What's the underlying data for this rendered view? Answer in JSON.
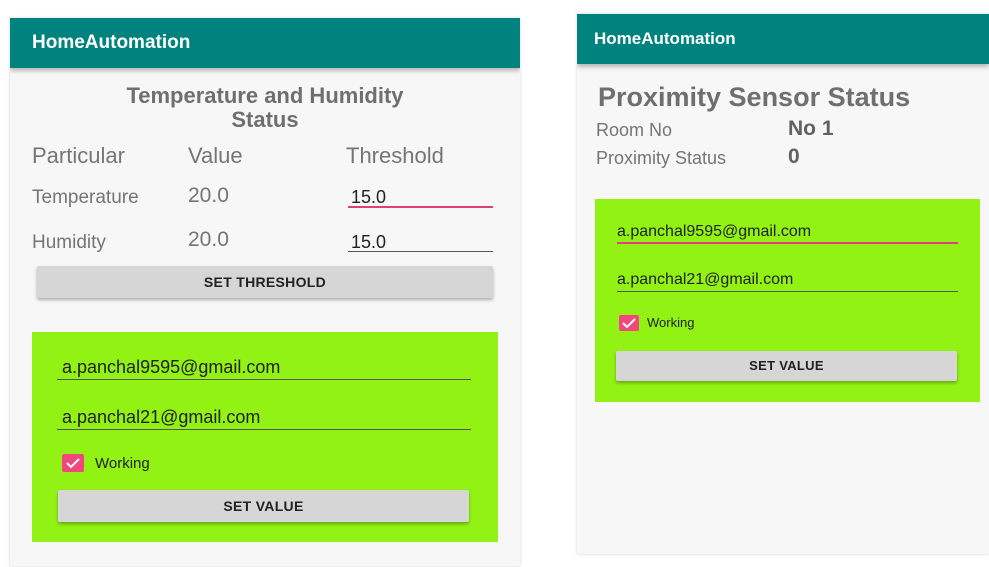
{
  "left_screen": {
    "app_title": "HomeAutomation",
    "heading_line1": "Temperature and Humidity",
    "heading_line2": "Status",
    "columns": {
      "particular": "Particular",
      "value": "Value",
      "threshold": "Threshold"
    },
    "rows": [
      {
        "particular": "Temperature",
        "value": "20.0",
        "threshold": "15.0"
      },
      {
        "particular": "Humidity",
        "value": "20.0",
        "threshold": "15.0"
      }
    ],
    "set_threshold_label": "SET THRESHOLD",
    "email1": "a.panchal9595@gmail.com",
    "email2": "a.panchal21@gmail.com",
    "checkbox_label": "Working",
    "checkbox_checked": true,
    "set_value_label": "SET VALUE"
  },
  "right_screen": {
    "app_title": "HomeAutomation",
    "heading": "Proximity Sensor Status",
    "room_label": "Room No",
    "room_value": "No 1",
    "proximity_label": "Proximity Status",
    "proximity_value": "0",
    "email1": "a.panchal9595@gmail.com",
    "email2": "a.panchal21@gmail.com",
    "checkbox_label": "Working",
    "checkbox_checked": true,
    "set_value_label": "SET VALUE"
  },
  "colors": {
    "appbar": "#00837f",
    "panel": "#92f213",
    "accent": "#e0407a",
    "checkbox": "#f2467c"
  }
}
